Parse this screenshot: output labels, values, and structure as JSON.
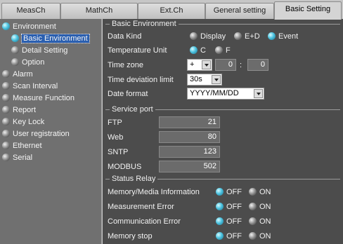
{
  "tabs": [
    "MeasCh",
    "MathCh",
    "Ext.Ch",
    "General setting",
    "Basic Setting"
  ],
  "active_tab": "Basic Setting",
  "sidebar": {
    "items": [
      {
        "label": "Environment",
        "indent": 0,
        "dot": "cyan"
      },
      {
        "label": "Basic Environment",
        "indent": 1,
        "dot": "cyan",
        "selected": true
      },
      {
        "label": "Detail Setting",
        "indent": 1,
        "dot": "gray"
      },
      {
        "label": "Option",
        "indent": 1,
        "dot": "gray"
      },
      {
        "label": "Alarm",
        "indent": 0,
        "dot": "gray"
      },
      {
        "label": "Scan Interval",
        "indent": 0,
        "dot": "gray"
      },
      {
        "label": "Measure Function",
        "indent": 0,
        "dot": "gray"
      },
      {
        "label": "Report",
        "indent": 0,
        "dot": "gray"
      },
      {
        "label": "Key Lock",
        "indent": 0,
        "dot": "gray"
      },
      {
        "label": "User registration",
        "indent": 0,
        "dot": "gray"
      },
      {
        "label": "Ethernet",
        "indent": 0,
        "dot": "gray"
      },
      {
        "label": "Serial",
        "indent": 0,
        "dot": "gray"
      }
    ]
  },
  "basic_env": {
    "title": "Basic Environment",
    "data_kind": {
      "label": "Data Kind",
      "options": [
        "Display",
        "E+D",
        "Event"
      ],
      "selected": "Event"
    },
    "temp_unit": {
      "label": "Temperature Unit",
      "options": [
        "C",
        "F"
      ],
      "selected": "C"
    },
    "time_zone": {
      "label": "Time zone",
      "sign": "+",
      "hours": "0",
      "separator": ":",
      "minutes": "0"
    },
    "time_dev": {
      "label": "Time deviation limit",
      "value": "30s"
    },
    "date_format": {
      "label": "Date format",
      "value": "YYYY/MM/DD"
    }
  },
  "service_port": {
    "title": "Service port",
    "ports": [
      {
        "label": "FTP",
        "value": "21"
      },
      {
        "label": "Web",
        "value": "80"
      },
      {
        "label": "SNTP",
        "value": "123"
      },
      {
        "label": "MODBUS",
        "value": "502"
      }
    ]
  },
  "status_relay": {
    "title": "Status Relay",
    "off_label": "OFF",
    "on_label": "ON",
    "rows": [
      {
        "label": "Memory/Media Information",
        "selected": "OFF"
      },
      {
        "label": "Measurement Error",
        "selected": "OFF"
      },
      {
        "label": "Communication Error",
        "selected": "OFF"
      },
      {
        "label": "Memory stop",
        "selected": "OFF"
      }
    ]
  },
  "colors": {
    "accent_cyan": "#4cc3e0",
    "panel_bg": "#4c4c4c",
    "sidebar_bg": "#707070",
    "selection": "#2a5fb0"
  }
}
